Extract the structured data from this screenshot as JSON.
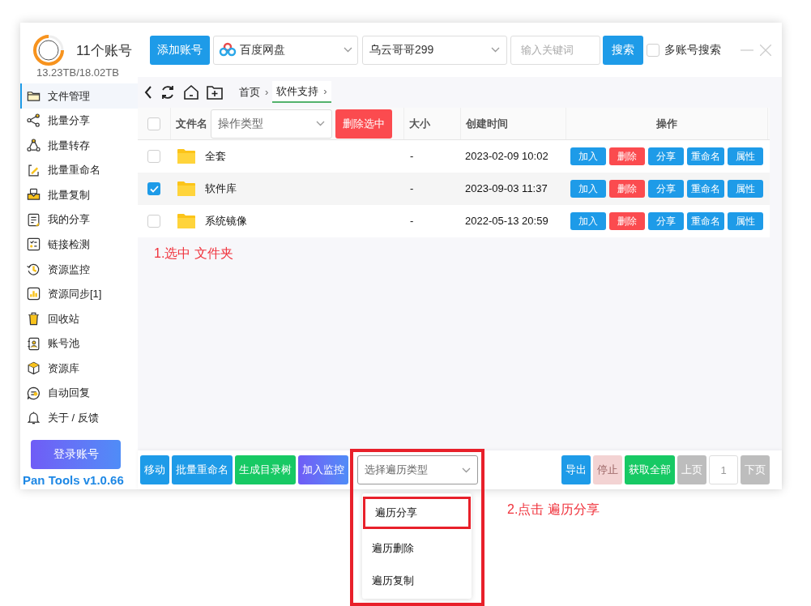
{
  "header": {
    "account_count": "11个账号",
    "storage": "13.23TB/18.02TB",
    "add_button": "添加账号",
    "drive_select": "百度网盘",
    "account_select": "乌云哥哥299",
    "search": {
      "placeholder": "输入关键词"
    },
    "search_button": "搜索",
    "multi_search": {
      "label": "多账号搜索",
      "checked": false
    }
  },
  "sidebar": {
    "items": [
      {
        "label": "文件管理",
        "selected": true
      },
      {
        "label": "批量分享",
        "selected": false
      },
      {
        "label": "批量转存",
        "selected": false
      },
      {
        "label": "批量重命名",
        "selected": false
      },
      {
        "label": "批量复制",
        "selected": false
      },
      {
        "label": "我的分享",
        "selected": false
      },
      {
        "label": "链接检测",
        "selected": false
      },
      {
        "label": "资源监控",
        "selected": false
      },
      {
        "label": "资源同步[1]",
        "selected": false
      },
      {
        "label": "回收站",
        "selected": false
      },
      {
        "label": "账号池",
        "selected": false
      },
      {
        "label": "资源库",
        "selected": false
      },
      {
        "label": "自动回复",
        "selected": false
      },
      {
        "label": "关于 / 反馈",
        "selected": false
      }
    ],
    "login_button": "登录账号",
    "version": "Pan Tools v1.0.66"
  },
  "breadcrumb": [
    {
      "label": "首页",
      "separator": "›",
      "selected": false
    },
    {
      "label": "软件支持",
      "separator": "›",
      "selected": true
    }
  ],
  "table": {
    "select_all": false,
    "columns": [
      "文件名",
      "大小",
      "创建时间",
      "操作"
    ],
    "op_type_select": "操作类型",
    "delete_selected": "删除选中",
    "rows": [
      {
        "checked": false,
        "name": "全套",
        "size": "-",
        "created": "2023-02-09 10:02",
        "actions": [
          {
            "label": "加入",
            "kind": "primary"
          },
          {
            "label": "删除",
            "kind": "danger"
          },
          {
            "label": "分享",
            "kind": "primary"
          },
          {
            "label": "重命名",
            "kind": "primary"
          },
          {
            "label": "属性",
            "kind": "primary"
          }
        ]
      },
      {
        "checked": true,
        "name": "软件库",
        "size": "-",
        "created": "2023-09-03 11:37",
        "actions": [
          {
            "label": "加入",
            "kind": "primary"
          },
          {
            "label": "删除",
            "kind": "danger"
          },
          {
            "label": "分享",
            "kind": "primary"
          },
          {
            "label": "重命名",
            "kind": "primary"
          },
          {
            "label": "属性",
            "kind": "primary"
          }
        ]
      },
      {
        "checked": false,
        "name": "系统镜像",
        "size": "-",
        "created": "2022-05-13 20:59",
        "actions": [
          {
            "label": "加入",
            "kind": "primary"
          },
          {
            "label": "删除",
            "kind": "danger"
          },
          {
            "label": "分享",
            "kind": "primary"
          },
          {
            "label": "重命名",
            "kind": "primary"
          },
          {
            "label": "属性",
            "kind": "primary"
          }
        ]
      }
    ]
  },
  "toolbar": {
    "left_buttons": [
      {
        "label": "移动",
        "kind": "primary"
      },
      {
        "label": "批量重命名",
        "kind": "primary"
      },
      {
        "label": "生成目录树",
        "kind": "success"
      },
      {
        "label": "加入监控",
        "kind": "monitor"
      }
    ],
    "traverse_select": {
      "placeholder": "选择遍历类型",
      "expanded": true,
      "options": [
        {
          "label": "遍历分享",
          "selected": true
        },
        {
          "label": "遍历删除",
          "selected": false
        },
        {
          "label": "遍历复制",
          "selected": false
        }
      ]
    },
    "right_buttons": [
      {
        "label": "导出",
        "kind": "primary",
        "disabled": false
      },
      {
        "label": "停止",
        "kind": "danger",
        "disabled": true
      },
      {
        "label": "获取全部",
        "kind": "success",
        "disabled": false
      },
      {
        "label": "上页",
        "kind": "gray",
        "disabled": true
      }
    ],
    "page": "1",
    "next_button": {
      "label": "下页",
      "kind": "gray",
      "disabled": true
    }
  },
  "annotations": [
    "1.选中 文件夹",
    "2.点击 遍历分享"
  ]
}
